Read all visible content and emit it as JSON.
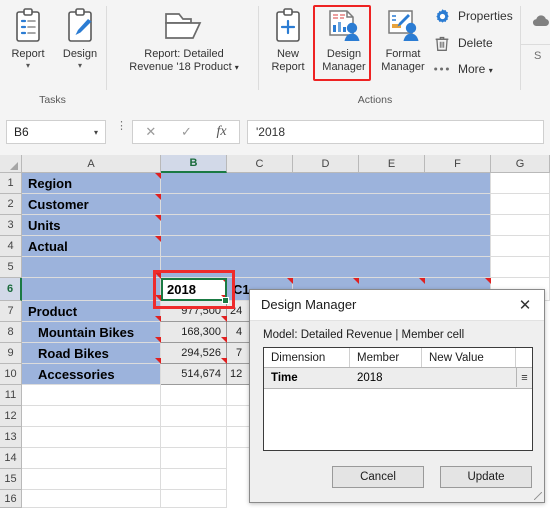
{
  "ribbon": {
    "groups": [
      {
        "label": "Tasks"
      },
      {
        "label": "Actions"
      }
    ],
    "buttons": {
      "report": {
        "label": "Report",
        "icon": "clipboard-list-icon"
      },
      "design": {
        "label": "Design",
        "icon": "clipboard-pen-icon"
      },
      "report_detailed": {
        "line1": "Report: Detailed",
        "line2": "Revenue '18 Product",
        "icon": "open-folder-icon"
      },
      "new_report": {
        "line1": "New",
        "line2": "Report",
        "icon": "clipboard-plus-icon"
      },
      "design_manager": {
        "line1": "Design",
        "line2": "Manager",
        "icon": "design-manager-icon"
      },
      "format_manager": {
        "line1": "Format",
        "line2": "Manager",
        "icon": "format-manager-icon"
      },
      "properties": {
        "label": "Properties",
        "icon": "gear-icon"
      },
      "delete": {
        "label": "Delete",
        "icon": "trash-icon"
      },
      "more": {
        "label": "More",
        "icon": "ellipsis-icon"
      }
    },
    "caret": "▾"
  },
  "formula_bar": {
    "name_box_value": "B6",
    "name_box_caret": "▾",
    "cancel_icon": "✕",
    "confirm_icon": "✓",
    "function_icon": "fx",
    "formula_value": "'2018"
  },
  "grid": {
    "columns": [
      "A",
      "B",
      "C",
      "D",
      "E",
      "F",
      "G"
    ],
    "rows": [
      "1",
      "2",
      "3",
      "4",
      "5",
      "6",
      "7",
      "8",
      "9",
      "10",
      "11",
      "12",
      "13",
      "14",
      "15",
      "16"
    ],
    "selected_column": "B",
    "selected_row": "6",
    "labels": {
      "r1": "Region",
      "r2": "Customer",
      "r3": "Units",
      "r4": "Actual",
      "r7": "Product",
      "r8": "Mountain Bikes",
      "r9": "Road Bikes",
      "r10": "Accessories"
    },
    "col_b": {
      "r6": "2018",
      "r7": "977,500",
      "r8": "168,300",
      "r9": "294,526",
      "r10": "514,674"
    },
    "col_c": {
      "r6": "C1",
      "r7": "24",
      "r8": "4",
      "r9": "7",
      "r10": "12"
    }
  },
  "dialog": {
    "title": "Design Manager",
    "close_icon": "✕",
    "model_line": "Model: Detailed Revenue | Member cell",
    "table": {
      "headers": [
        "Dimension",
        "Member",
        "New Value"
      ],
      "rows": [
        {
          "dimension": "Time",
          "member": "2018",
          "new_value": "",
          "grip": "≡"
        }
      ]
    },
    "buttons": {
      "cancel": "Cancel",
      "update": "Update"
    }
  },
  "colors": {
    "selection_fill": "#9CB3DC",
    "highlight_red": "#EE2B2B",
    "active_cell_green": "#1A7A43",
    "accent_blue": "#2B7CD3"
  }
}
